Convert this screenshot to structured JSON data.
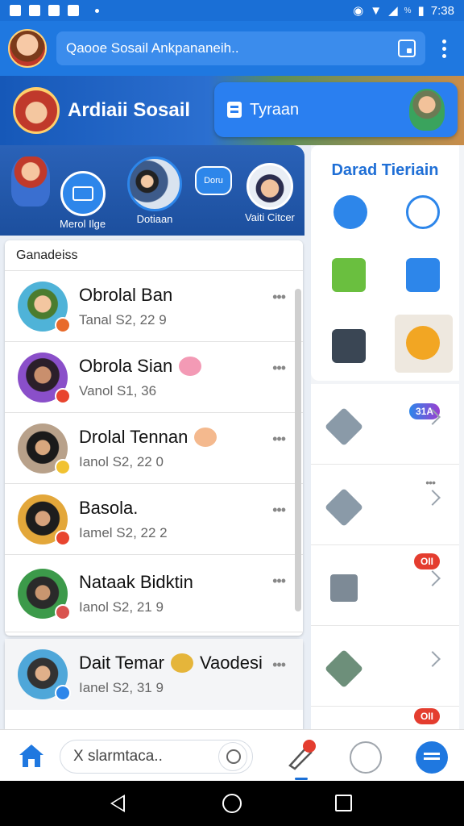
{
  "status_bar": {
    "time": "7:38",
    "battery_label": "%",
    "icons": [
      "notification-icon",
      "mail-icon",
      "settings-icon",
      "screenshot-icon",
      "dot-icon",
      "alarm-icon",
      "wifi-icon",
      "signal-icon",
      "battery-icon"
    ]
  },
  "header": {
    "search_text": "Qaooe Sosail Ankpananeih..",
    "icons": [
      "app-avatar",
      "save-icon",
      "kebab-menu-icon"
    ]
  },
  "banner": {
    "title": "Ardiaii Sosail",
    "button_label": "Tyraan"
  },
  "stories": [
    {
      "label": "Merol Ilge"
    },
    {
      "label": "Dotiaan"
    },
    {
      "label": "Doru"
    },
    {
      "label": "Vaiti Citcer"
    }
  ],
  "conversations": {
    "heading": "Ganadeiss",
    "items": [
      {
        "name": "Obrolal Ban",
        "meta": "Tanal  S2, 22  9",
        "emoji": ""
      },
      {
        "name": "Obrola Sian",
        "meta": "Vanol  S1, 36",
        "emoji": "pig"
      },
      {
        "name": "Drolal Tennan",
        "meta": "Ianol  S2, 22  0",
        "emoji": "monkey"
      },
      {
        "name": "Basola.",
        "meta": "Iamel  S2, 22  2",
        "emoji": ""
      },
      {
        "name": "Nataak Bidktin",
        "meta": "Ianol  S2, 21  9",
        "emoji": ""
      },
      {
        "name": "Dait Temar",
        "meta": "Ianel  S2, 31  9",
        "emoji": "face",
        "extra": "Vaodesi"
      }
    ]
  },
  "right_panel": {
    "title": "Darad Tieriain",
    "pills": [
      "31A",
      "OII",
      "OII"
    ]
  },
  "bottom_nav": {
    "search_text": "X slarmtaca.."
  },
  "colors": {
    "primary": "#1f78e0",
    "header": "#1a6fd6",
    "accent_red": "#e43d2f",
    "accent_green": "#5ab04a",
    "accent_orange": "#f2a623"
  }
}
